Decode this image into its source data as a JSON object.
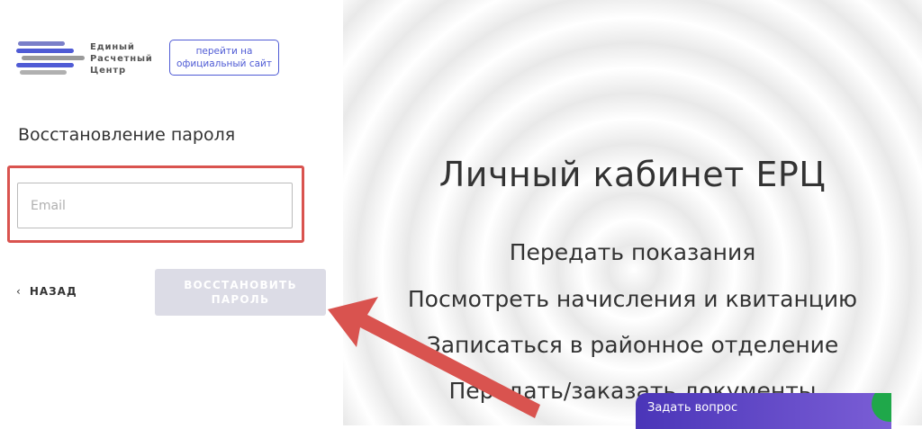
{
  "header": {
    "logo_text_line1": "Единый",
    "logo_text_line2": "Расчетный",
    "logo_text_line3": "Центр",
    "official_site_button_line1": "перейти на",
    "official_site_button_line2": "официальный сайт"
  },
  "form": {
    "title": "Восстановление пароля",
    "email_placeholder": "Email",
    "back_label": "НАЗАД",
    "back_icon": "chevron-left-icon",
    "restore_button_line1": "ВОССТАНОВИТЬ",
    "restore_button_line2": "ПАРОЛЬ"
  },
  "hero": {
    "title": "Личный кабинет ЕРЦ",
    "features": [
      "Передать показания",
      "Посмотреть начисления и квитанцию",
      "Записаться в районное отделение",
      "Передать/заказать документы"
    ]
  },
  "chat": {
    "ask_label": "Задать вопрос"
  },
  "colors": {
    "accent": "#4f5bd5",
    "highlight": "#d9534f",
    "button_disabled": "#dcdce6",
    "chat_gradient_start": "#4a35b8",
    "chat_gradient_end": "#7b5ed6"
  }
}
